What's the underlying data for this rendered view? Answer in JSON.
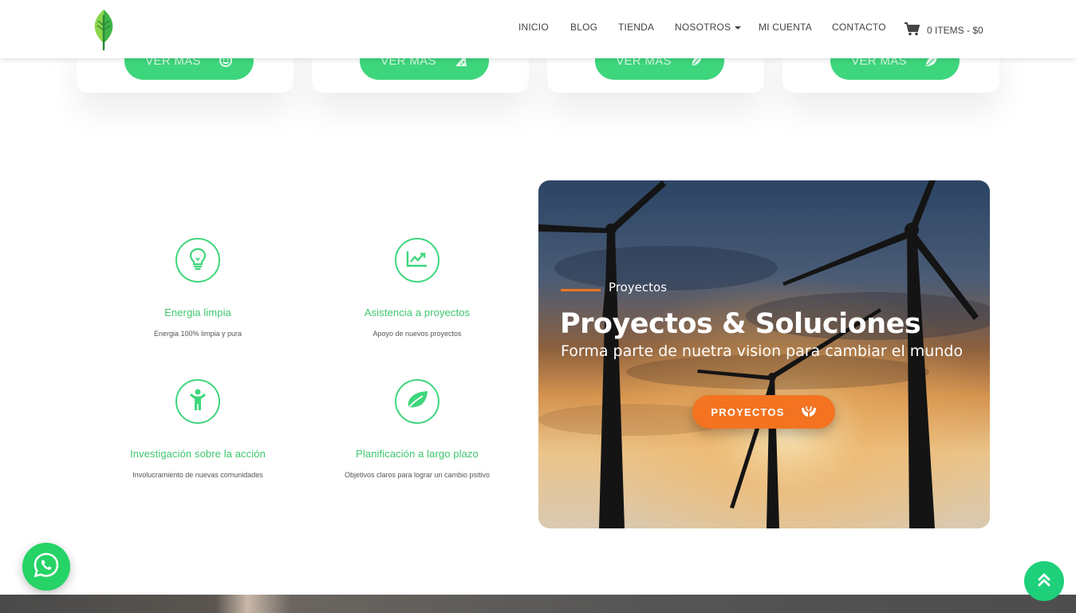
{
  "header": {
    "nav": [
      "INICIO",
      "BLOG",
      "TIENDA",
      "NOSOTROS",
      "MI CUENTA",
      "CONTACTO"
    ],
    "cart_label": "0 ITEMS - $0"
  },
  "cards": [
    {
      "button_label": "VER MÁS",
      "icon": "smile-icon"
    },
    {
      "button_label": "VER MÁS",
      "icon": "pizza-icon"
    },
    {
      "button_label": "VER MÁS",
      "icon": "leaf-hand-icon"
    },
    {
      "button_label": "VER MÁS",
      "icon": "leaf-icon"
    }
  ],
  "features": [
    {
      "title": "Energia limpia",
      "desc": "Energia 100% limpia y pura",
      "icon": "lightbulb-icon"
    },
    {
      "title": "Asistencia a proyectos",
      "desc": "Apoyo de nuevos proyectos",
      "icon": "chart-line-icon"
    },
    {
      "title": "Investigación sobre la acción",
      "desc": "Involucramiento de nuevas comunidades",
      "icon": "child-icon"
    },
    {
      "title": "Planificación a largo plazo",
      "desc": "Objetivos claros para lograr un cambio psitivo",
      "icon": "leaf-icon"
    }
  ],
  "hero": {
    "eyebrow": "Proyectos",
    "title": "Proyectos & Soluciones",
    "subtitle": "Forma parte de nuetra vision para cambiar el mundo",
    "button_label": "PROYECTOS",
    "button_icon": "hands-icon"
  },
  "colors": {
    "green": "#3ed67c",
    "orange": "#f37321",
    "whatsapp": "#25d366"
  }
}
